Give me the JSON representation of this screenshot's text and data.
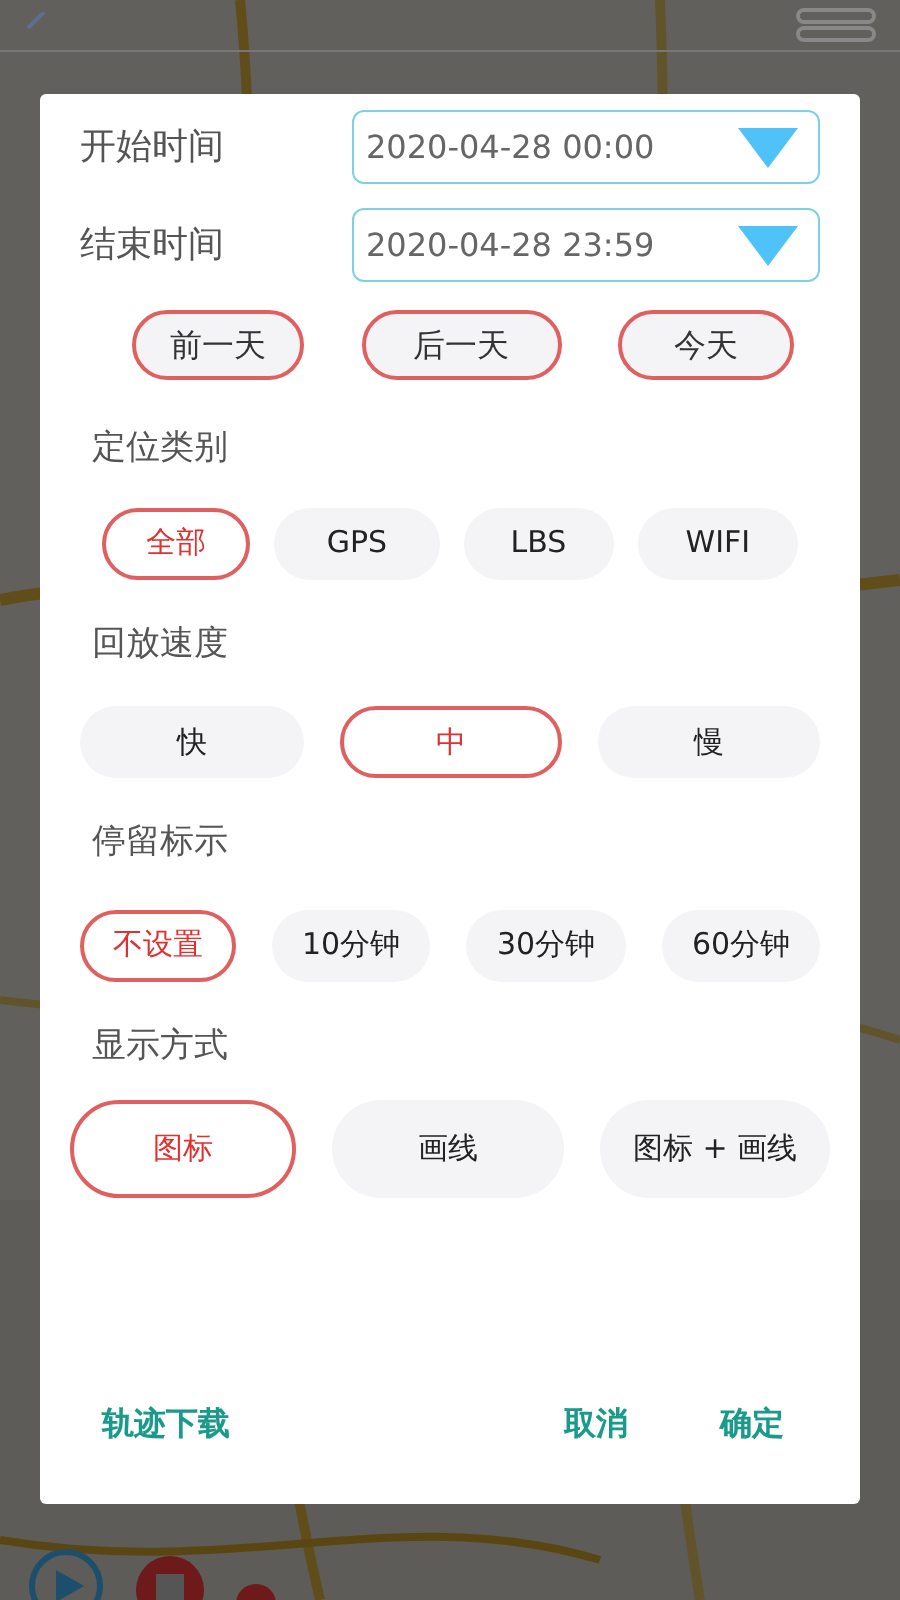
{
  "dialog": {
    "time_fields": [
      {
        "label": "开始时间",
        "value": "2020-04-28 00:00"
      },
      {
        "label": "结束时间",
        "value": "2020-04-28 23:59"
      }
    ],
    "day_buttons": [
      "前一天",
      "后一天",
      "今天"
    ],
    "groups": [
      {
        "title": "定位类别",
        "options": [
          {
            "label": "全部",
            "selected": true
          },
          {
            "label": "GPS",
            "selected": false
          },
          {
            "label": "LBS",
            "selected": false
          },
          {
            "label": "WIFI",
            "selected": false
          }
        ]
      },
      {
        "title": "回放速度",
        "options": [
          {
            "label": "快",
            "selected": false
          },
          {
            "label": "中",
            "selected": true
          },
          {
            "label": "慢",
            "selected": false
          }
        ]
      },
      {
        "title": "停留标示",
        "options": [
          {
            "label": "不设置",
            "selected": true
          },
          {
            "label": "10分钟",
            "selected": false
          },
          {
            "label": "30分钟",
            "selected": false
          },
          {
            "label": "60分钟",
            "selected": false
          }
        ]
      },
      {
        "title": "显示方式",
        "options": [
          {
            "label": "图标",
            "selected": true
          },
          {
            "label": "画线",
            "selected": false
          },
          {
            "label": "图标 + 画线",
            "selected": false
          }
        ]
      }
    ],
    "footer": {
      "download": "轨迹下载",
      "cancel": "取消",
      "confirm": "确定"
    }
  }
}
